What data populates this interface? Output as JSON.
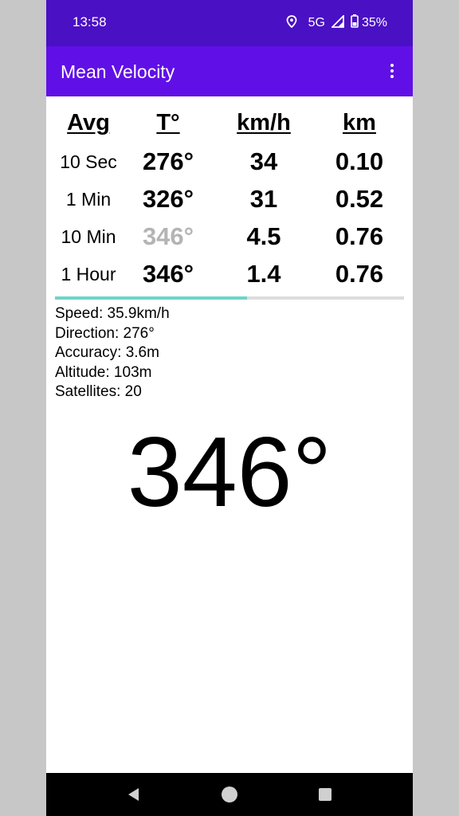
{
  "status_bar": {
    "time": "13:58",
    "network": "5G",
    "battery": "35%",
    "icons": [
      "location-icon",
      "signal-icon",
      "battery-icon"
    ]
  },
  "app_bar": {
    "title": "Mean Velocity",
    "menu_icon": "more-vert-icon"
  },
  "table": {
    "headers": [
      "Avg",
      "T°",
      "km/h",
      "km"
    ],
    "rows": [
      {
        "label": "10 Sec",
        "direction": "276°",
        "speed": "34",
        "distance": "0.10",
        "direction_faded": false
      },
      {
        "label": "1 Min",
        "direction": "326°",
        "speed": "31",
        "distance": "0.52",
        "direction_faded": false
      },
      {
        "label": "10 Min",
        "direction": "346°",
        "speed": "4.5",
        "distance": "0.76",
        "direction_faded": true
      },
      {
        "label": "1 Hour",
        "direction": "346°",
        "speed": "1.4",
        "distance": "0.76",
        "direction_faded": false
      }
    ]
  },
  "progress": {
    "fraction": 0.55,
    "fill_color": "#6fd3c8",
    "track_color": "#dcdcdc"
  },
  "info": {
    "speed": "Speed: 35.9km/h",
    "direction": "Direction: 276°",
    "accuracy": "Accuracy: 3.6m",
    "altitude": "Altitude: 103m",
    "satellites": "Satellites: 20"
  },
  "big_direction": "346°",
  "nav_bar": {
    "icons": [
      "back-icon",
      "home-icon",
      "recents-icon"
    ]
  },
  "colors": {
    "status_bar": "#4a10c4",
    "app_bar": "#6010e6",
    "faded_text": "#b4b4b4"
  }
}
